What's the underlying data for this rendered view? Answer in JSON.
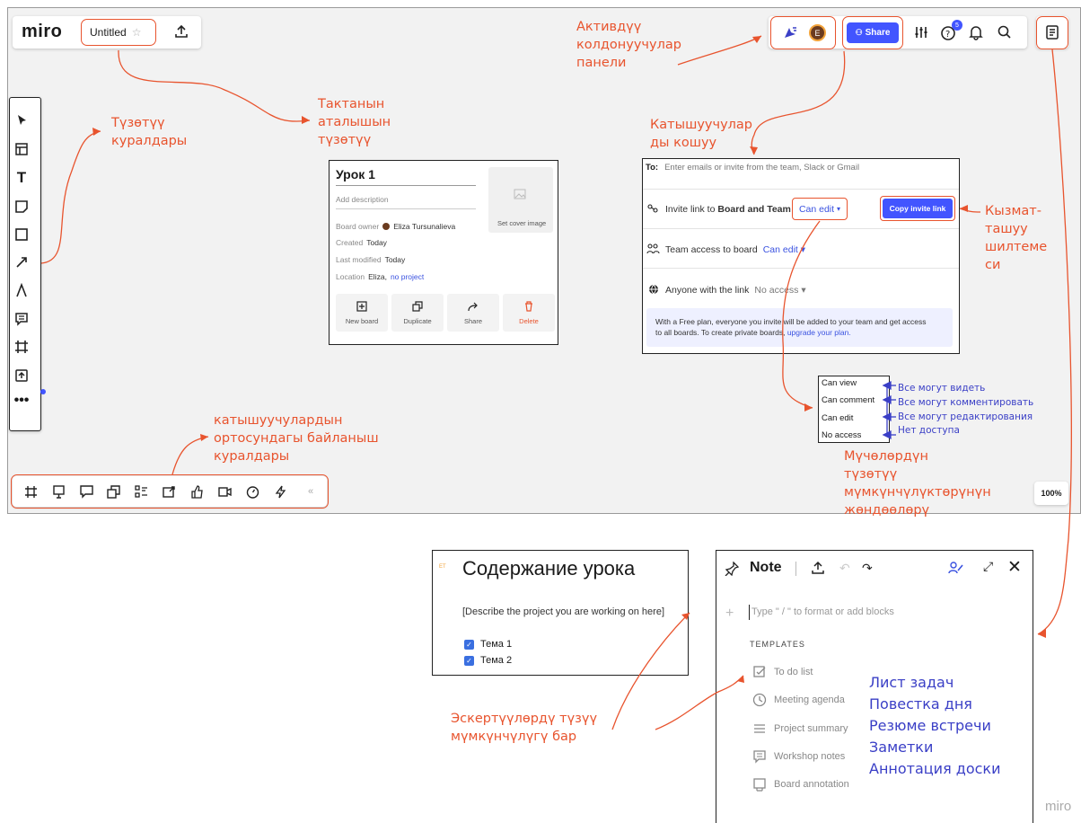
{
  "board": {
    "logo": "miro",
    "title": "Untitled",
    "zoom": "100%",
    "share_label": "Share",
    "avatar_letter": "E",
    "notif_count": "5"
  },
  "board_card": {
    "title": "Урок 1",
    "description_placeholder": "Add description",
    "owner_label": "Board owner",
    "owner_name": "Eliza Tursunalieva",
    "created_label": "Created",
    "created_value": "Today",
    "modified_label": "Last modified",
    "modified_value": "Today",
    "location_label": "Location",
    "location_value": "Eliza,",
    "location_link": "no project",
    "cover_label": "Set cover image",
    "actions": [
      "New board",
      "Duplicate",
      "Share",
      "Delete"
    ]
  },
  "share_dialog": {
    "to_label": "To:",
    "to_placeholder": "Enter emails or invite from the team, Slack or Gmail",
    "invite_prefix": "Invite link to ",
    "invite_bold": "Board and Team",
    "invite_perm": "Can edit",
    "copy_link": "Copy invite link",
    "team_access": "Team access to board",
    "team_perm": "Can edit",
    "anyone_link": "Anyone with the link",
    "anyone_perm": "No access",
    "info_line1": "With a Free plan, everyone you invite will be added to your team and get access",
    "info_line2": "to all boards. To create private boards,",
    "info_link": "upgrade your plan."
  },
  "perm_options": [
    "Can view",
    "Can comment",
    "Can edit",
    "No access"
  ],
  "perm_ru": [
    "Все могут видеть",
    "Все могут комментировать",
    "Все могут редактирования",
    "Нет доступа"
  ],
  "annotations": {
    "tools": "Түзөтүү куралдары",
    "title_edit": "Тактанын аталышын түзөтүү",
    "active_users": "Активдүү колдонуучулар панели",
    "add_users": "Катышуучулар ды кошуу",
    "share_link": "Кызмат- ташуу шилтеме си",
    "comm_tools": "катышуучулардын ортосундагы байланыш куралдары",
    "perm_settings": "Мүчөлөрдүн түзөтүү мүмкүнчүлүктөрүнүн жөндөөлөрү",
    "notes": "Эскертүүлөрдү түзүү мүмкүнчүлүгү бар"
  },
  "lesson": {
    "title": "Содержание урока",
    "placeholder": "[Describe the project you are working on here]",
    "items": [
      "Тема 1",
      "Тема 2"
    ]
  },
  "note": {
    "title": "Note",
    "input_placeholder": "Type \" / \" to format or add blocks",
    "templates_header": "TEMPLATES",
    "templates": [
      "To do list",
      "Meeting agenda",
      "Project summary",
      "Workshop notes",
      "Board annotation"
    ],
    "templates_ru": [
      "Лист задач",
      "Повестка дня",
      "Резюме встречи",
      "Заметки",
      "Аннотация доски"
    ]
  },
  "footer_logo": "miro"
}
